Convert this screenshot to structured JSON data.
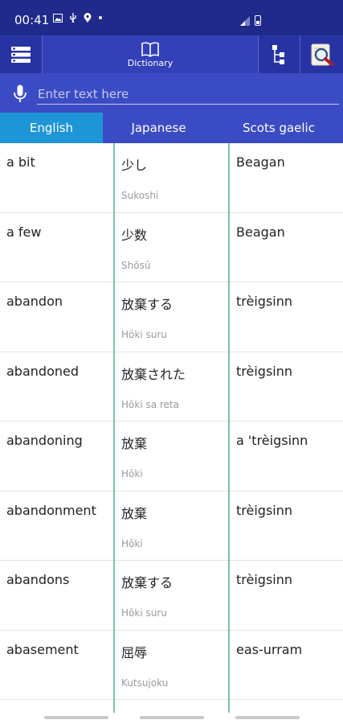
{
  "status_bar": {
    "time": "00:41",
    "icons": [
      "gallery-icon",
      "usb-icon",
      "location-icon",
      "dot-icon"
    ]
  },
  "app_bar": {
    "menu_icon": "menu-list-icon",
    "dictionary_icon": "book-icon",
    "dictionary_label": "Dictionary",
    "tree_icon": "tree-structure-icon",
    "search_icon": "magnifier-document-icon"
  },
  "input": {
    "placeholder": "Enter text here",
    "mic_icon": "microphone-icon"
  },
  "tabs": [
    {
      "label": "English",
      "active": true
    },
    {
      "label": "Japanese",
      "active": false
    },
    {
      "label": "Scots gaelic",
      "active": false
    }
  ],
  "rows": [
    {
      "english": "a bit",
      "japanese": "少し",
      "romaji": "Sukoshi",
      "gaelic": "Beagan"
    },
    {
      "english": "a few",
      "japanese": "少数",
      "romaji": "Shōsū",
      "gaelic": "Beagan"
    },
    {
      "english": "abandon",
      "japanese": "放棄する",
      "romaji": "Hōki suru",
      "gaelic": "trèigsinn"
    },
    {
      "english": "abandoned",
      "japanese": "放棄された",
      "romaji": "Hōki sa reta",
      "gaelic": "trèigsinn"
    },
    {
      "english": "abandoning",
      "japanese": "放棄",
      "romaji": "Hōki",
      "gaelic": "a 'trèigsinn"
    },
    {
      "english": "abandonment",
      "japanese": "放棄",
      "romaji": "Hōki",
      "gaelic": "trèigsinn"
    },
    {
      "english": "abandons",
      "japanese": "放棄する",
      "romaji": "Hōki suru",
      "gaelic": "trèigsinn"
    },
    {
      "english": "abasement",
      "japanese": "屈辱",
      "romaji": "Kutsujoku",
      "gaelic": "eas-urram"
    }
  ],
  "colors": {
    "status_bg": "#1f2a8a",
    "app_bar_bg": "#2833a3",
    "input_bar_bg": "#3b4bc3",
    "active_tab": "#1e95d6",
    "column_divider": "#7fbfb3"
  }
}
